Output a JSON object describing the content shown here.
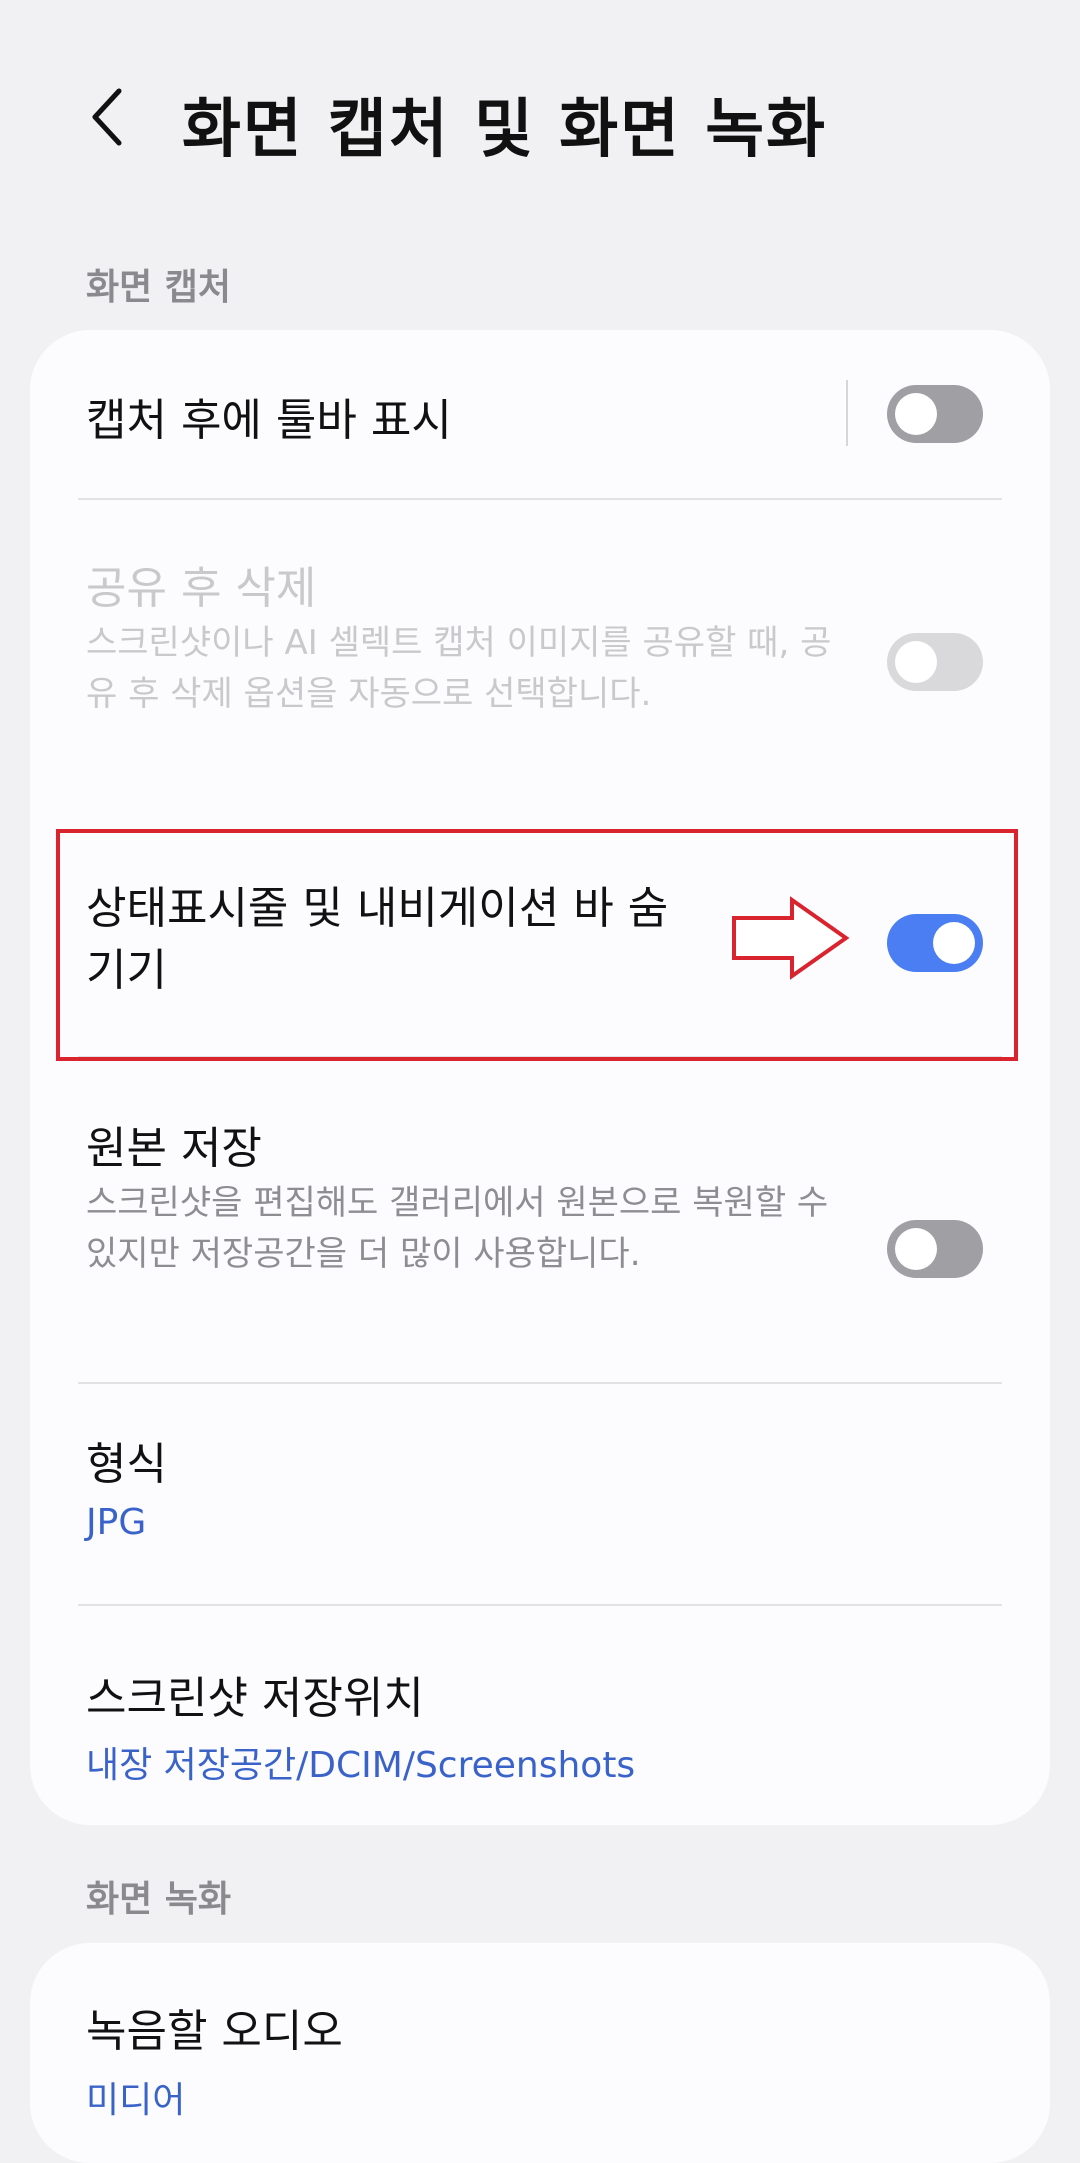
{
  "header": {
    "title": "화면 캡처 및 화면 녹화"
  },
  "sections": {
    "capture_header": "화면 캡처",
    "recording_header": "화면 녹화"
  },
  "capture": {
    "toolbar": {
      "title": "캡처 후에 툴바 표시",
      "enabled": false
    },
    "delete_after_share": {
      "title": "공유 후 삭제",
      "description": "스크린샷이나 AI 셀렉트 캡처 이미지를 공유할 때, 공유 후 삭제 옵션을 자동으로 선택합니다.",
      "enabled": false,
      "disabled": true
    },
    "hide_bars": {
      "title": "상태표시줄 및 내비게이션 바 숨기기",
      "enabled": true
    },
    "keep_original": {
      "title": "원본 저장",
      "description": "스크린샷을 편집해도 갤러리에서 원본으로 복원할 수 있지만 저장공간을 더 많이 사용합니다.",
      "enabled": false
    },
    "format": {
      "title": "형식",
      "value": "JPG"
    },
    "save_location": {
      "title": "스크린샷 저장위치",
      "value": "내장 저장공간/DCIM/Screenshots"
    }
  },
  "recording": {
    "audio": {
      "title": "녹음할 오디오",
      "value": "미디어"
    }
  },
  "colors": {
    "accent": "#4a7ef2",
    "link": "#3a63c9",
    "highlight": "#d9232f",
    "background": "#f1f1f3",
    "card": "#fcfcfe"
  },
  "icons": {
    "back": "chevron-left-icon",
    "annotation": "right-arrow-outline-icon"
  }
}
